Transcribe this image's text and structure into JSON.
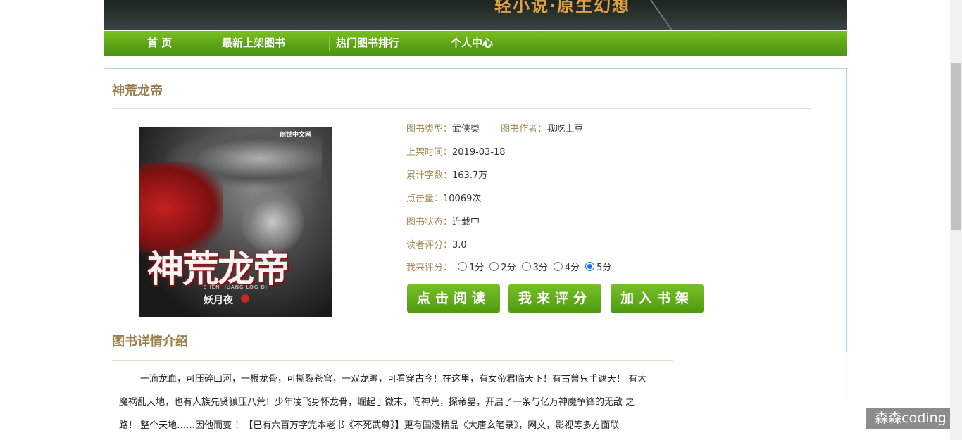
{
  "banner": {
    "title": "轻小说·原生幻想"
  },
  "nav": {
    "items": [
      "首 页",
      "最新上架图书",
      "热门图书排行",
      "个人中心"
    ]
  },
  "book": {
    "title": "神荒龙帝",
    "cover": {
      "title": "神荒龙帝",
      "pinyin": "SHEN HUANG LOG DI",
      "author": "妖月夜",
      "logo": "创世中文网"
    },
    "type_label": "图书类型：",
    "type": "武侠类",
    "author_label": "图书作者：",
    "author": "我吃土豆",
    "date_label": "上架时间：",
    "date": "2019-03-18",
    "words_label": "累计字数：",
    "words": "163.7万",
    "clicks_label": "点击量：",
    "clicks": "10069次",
    "status_label": "图书状态：",
    "status": "连载中",
    "score_label": "读者评分：",
    "score": "3.0",
    "my_score_label": "我来评分：",
    "score_options": [
      "1分",
      "2分",
      "3分",
      "4分",
      "5分"
    ],
    "selected_score": "5分"
  },
  "buttons": {
    "read": "点击阅读",
    "rate": "我来评分",
    "shelf": "加入书架"
  },
  "detail": {
    "heading": "图书详情介绍",
    "line1": "一滴龙血，可压碎山河，一根龙骨，可撕裂苍穹，一双龙眸，可看穿古今！在这里，有女帝君临天下！有古兽只手遮天！ 有大",
    "line2": "魔祸乱天地，也有人族先贤镇压八荒！少年凌飞身怀龙骨，崛起于微末，闯神荒，探帝墓，开启了一条与亿万神魔争锋的无敌 之",
    "line3": "路！ 整个天地……因他而变 ！【已有六百万字完本老书《不死武尊》】更有国漫精品《大唐玄笔录》，网文，影视等多方面联"
  },
  "watermark": "森森coding"
}
